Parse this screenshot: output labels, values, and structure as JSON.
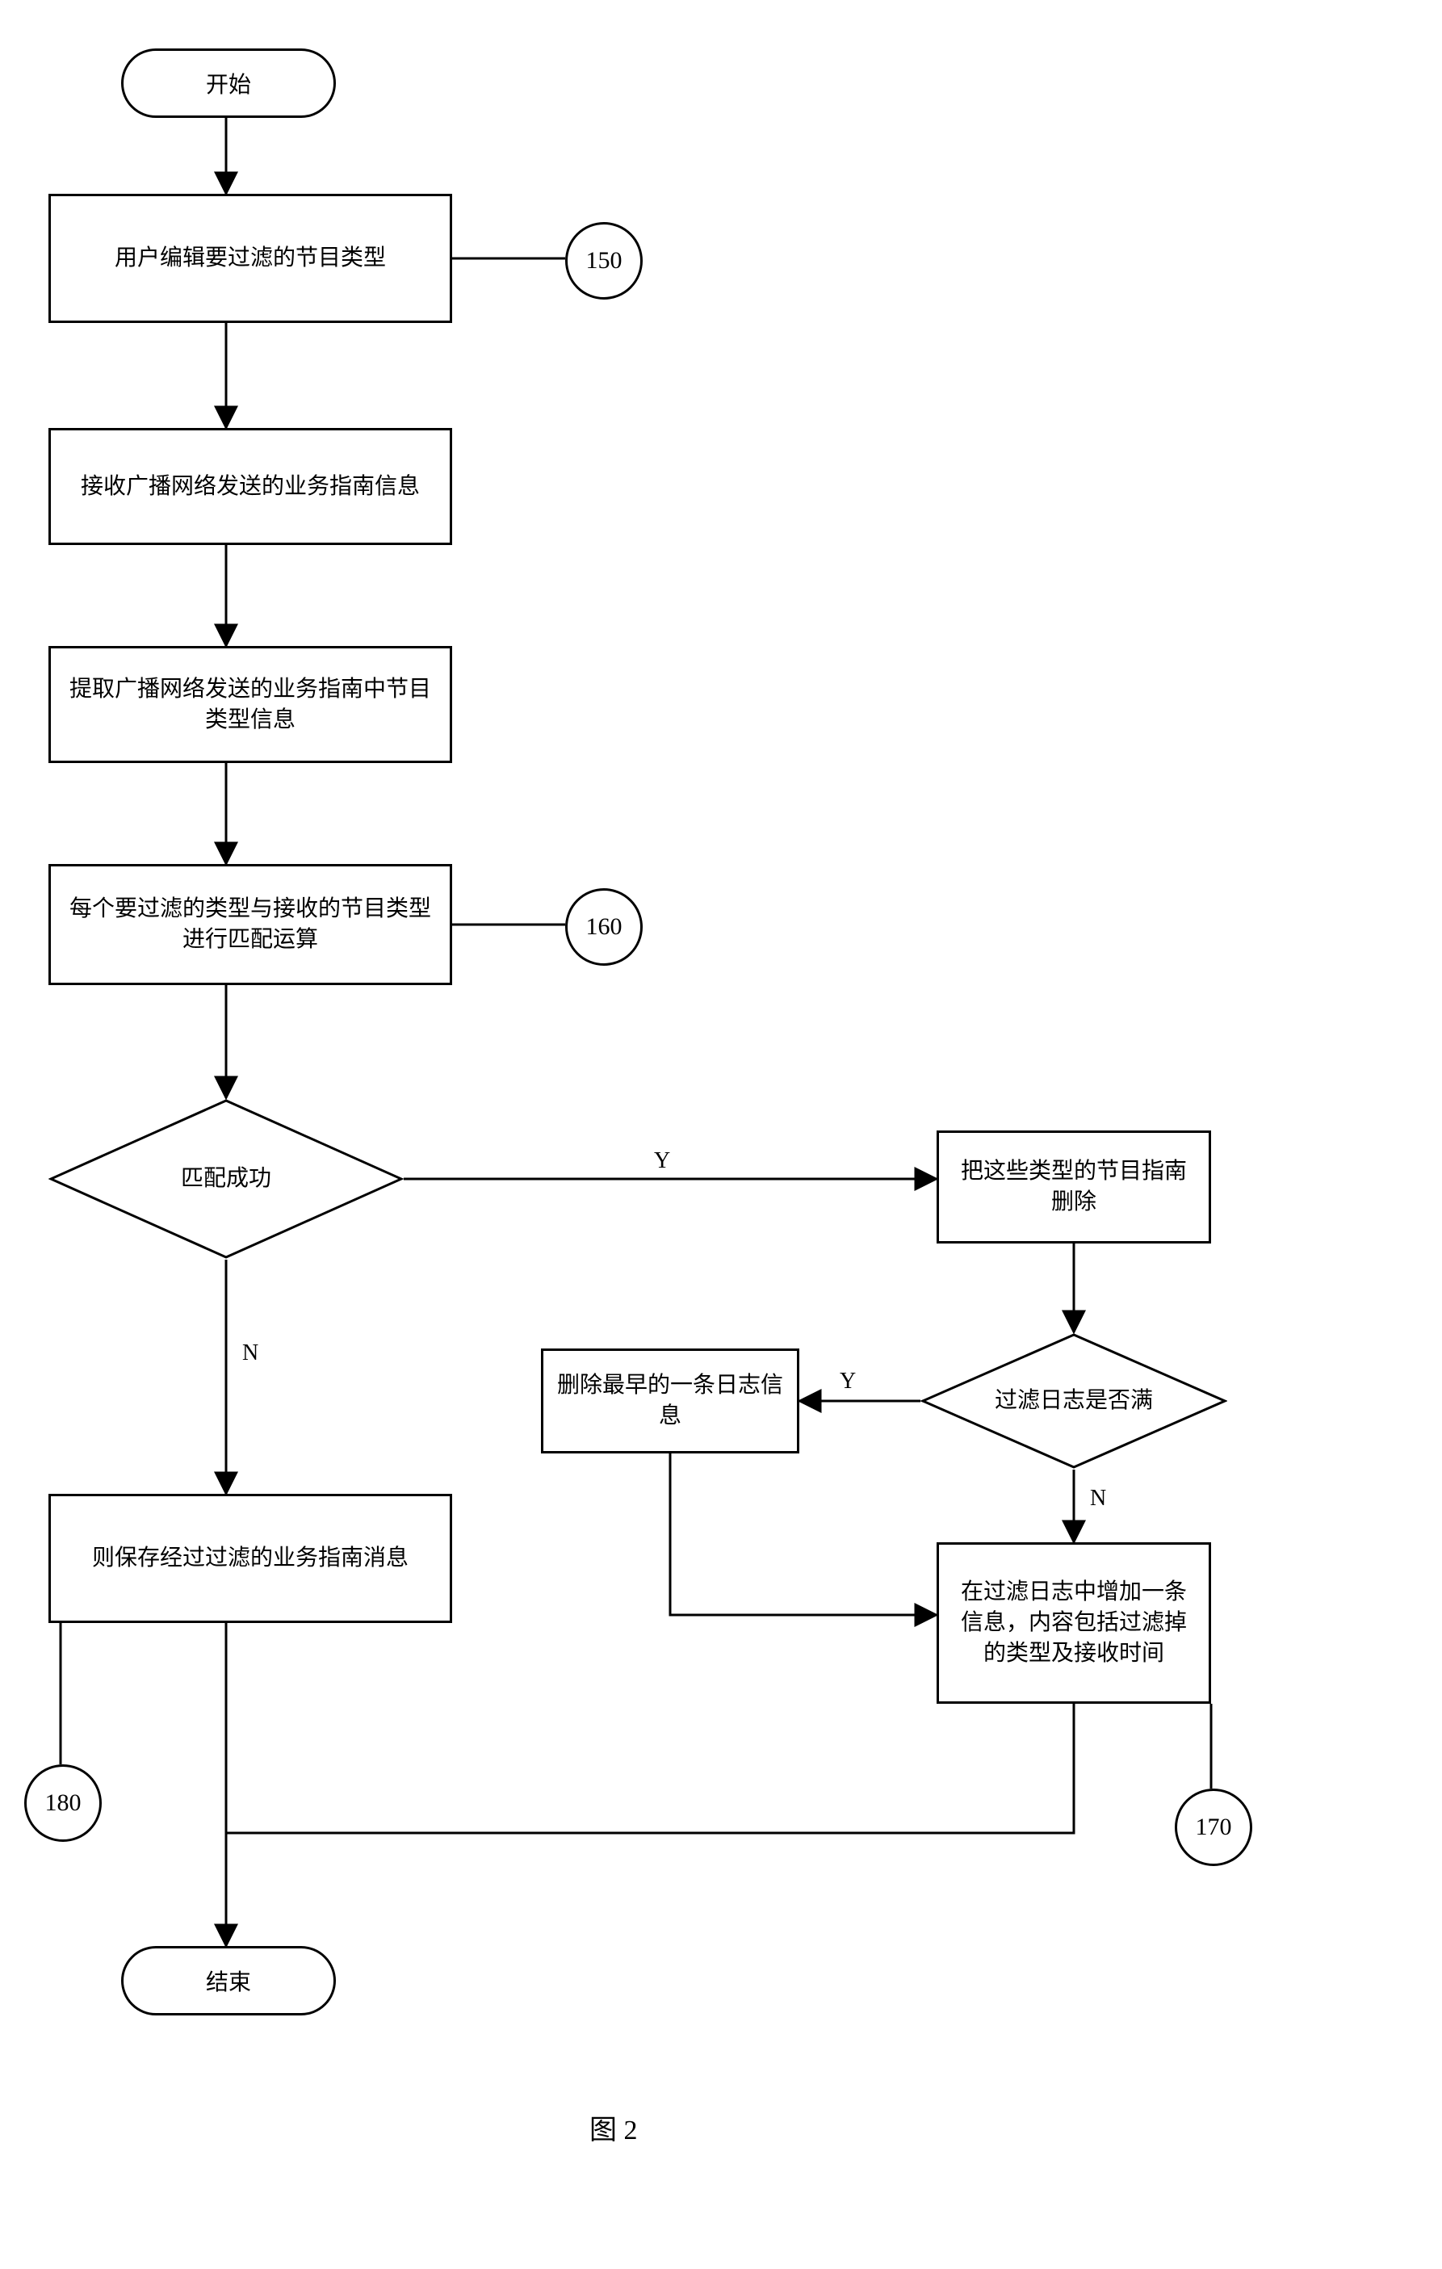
{
  "nodes": {
    "start": "开始",
    "end": "结束",
    "n1": "用户编辑要过滤的节目类型",
    "n2": "接收广播网络发送的业务指南信息",
    "n3": "提取广播网络发送的业务指南中节目类型信息",
    "n4": "每个要过滤的类型与接收的节目类型进行匹配运算",
    "d1": "匹配成功",
    "n5": "把这些类型的节目指南删除",
    "d2": "过滤日志是否满",
    "n6": "删除最早的一条日志信息",
    "n7": "在过滤日志中增加一条信息，内容包括过滤掉的类型及接收时间",
    "n8": "则保存经过过滤的业务指南消息"
  },
  "circles": {
    "c150": "150",
    "c160": "160",
    "c170": "170",
    "c180": "180"
  },
  "edges": {
    "y": "Y",
    "n": "N"
  },
  "caption": "图 2"
}
